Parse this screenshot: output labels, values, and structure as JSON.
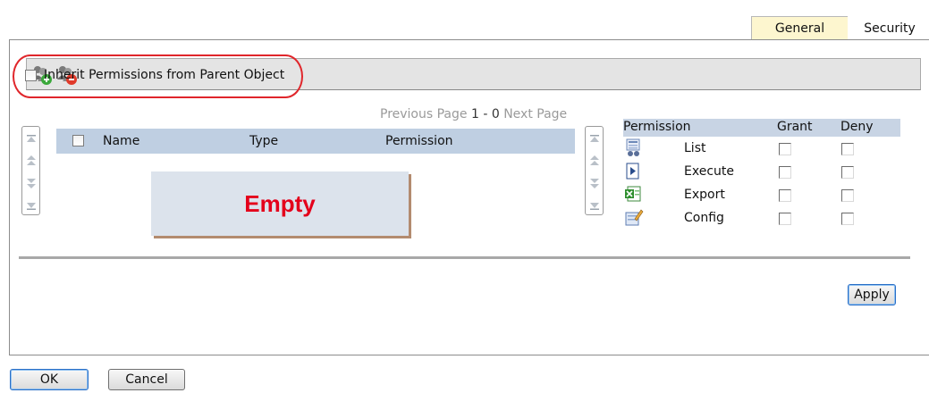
{
  "tabs": {
    "general": "General",
    "security": "Security"
  },
  "toolbar": {
    "add_icon": "add-user-icon",
    "remove_icon": "remove-user-icon"
  },
  "inherit": {
    "label": "Inherit Permissions from Parent Object",
    "checked": false
  },
  "pager": {
    "prev": "Previous Page",
    "current": "1 - 0",
    "next": "Next Page"
  },
  "members_table": {
    "columns": {
      "name": "Name",
      "type": "Type",
      "permission": "Permission"
    },
    "rows": [],
    "empty_text": "Empty"
  },
  "permissions_table": {
    "columns": {
      "permission": "Permission",
      "grant": "Grant",
      "deny": "Deny"
    },
    "rows": [
      {
        "label": "List",
        "icon": "list-icon",
        "grant": false,
        "deny": false
      },
      {
        "label": "Execute",
        "icon": "execute-icon",
        "grant": false,
        "deny": false
      },
      {
        "label": "Export",
        "icon": "export-excel-icon",
        "grant": false,
        "deny": false
      },
      {
        "label": "Config",
        "icon": "config-edit-icon",
        "grant": false,
        "deny": false
      }
    ]
  },
  "buttons": {
    "apply": "Apply",
    "ok": "OK",
    "cancel": "Cancel"
  },
  "colors": {
    "highlight_ring": "#e0262b",
    "empty_text": "#e4001b",
    "header_bg": "#bfcfe2",
    "general_tab_bg": "#fdf6cf"
  }
}
